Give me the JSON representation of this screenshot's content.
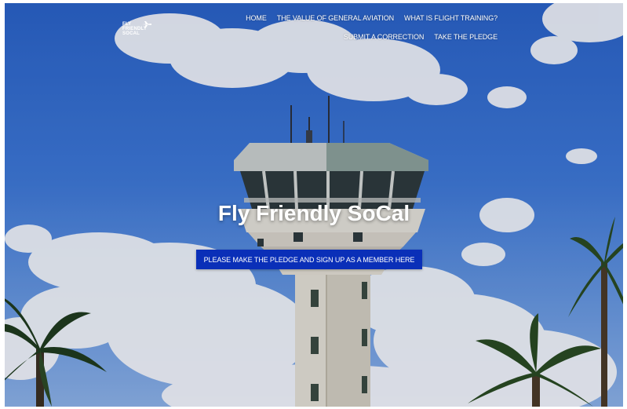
{
  "site": {
    "logo_lines": [
      "FLY",
      "FRIENDLY",
      "SOCAL"
    ]
  },
  "nav": {
    "row1": [
      "HOME",
      "THE VALUE OF GENERAL AVIATION",
      "WHAT IS FLIGHT TRAINING?"
    ],
    "row2": [
      "SUBMIT A CORRECTION",
      "TAKE THE PLEDGE"
    ]
  },
  "hero": {
    "title": "Fly Friendly SoCal",
    "cta_label": "PLEASE MAKE THE PLEDGE AND SIGN UP AS A MEMBER HERE",
    "background": "control tower against blue sky with clouds and palm trees"
  },
  "colors": {
    "sky": "#3f7ad8",
    "cta": "#0a2fb8",
    "text": "#ffffff"
  }
}
